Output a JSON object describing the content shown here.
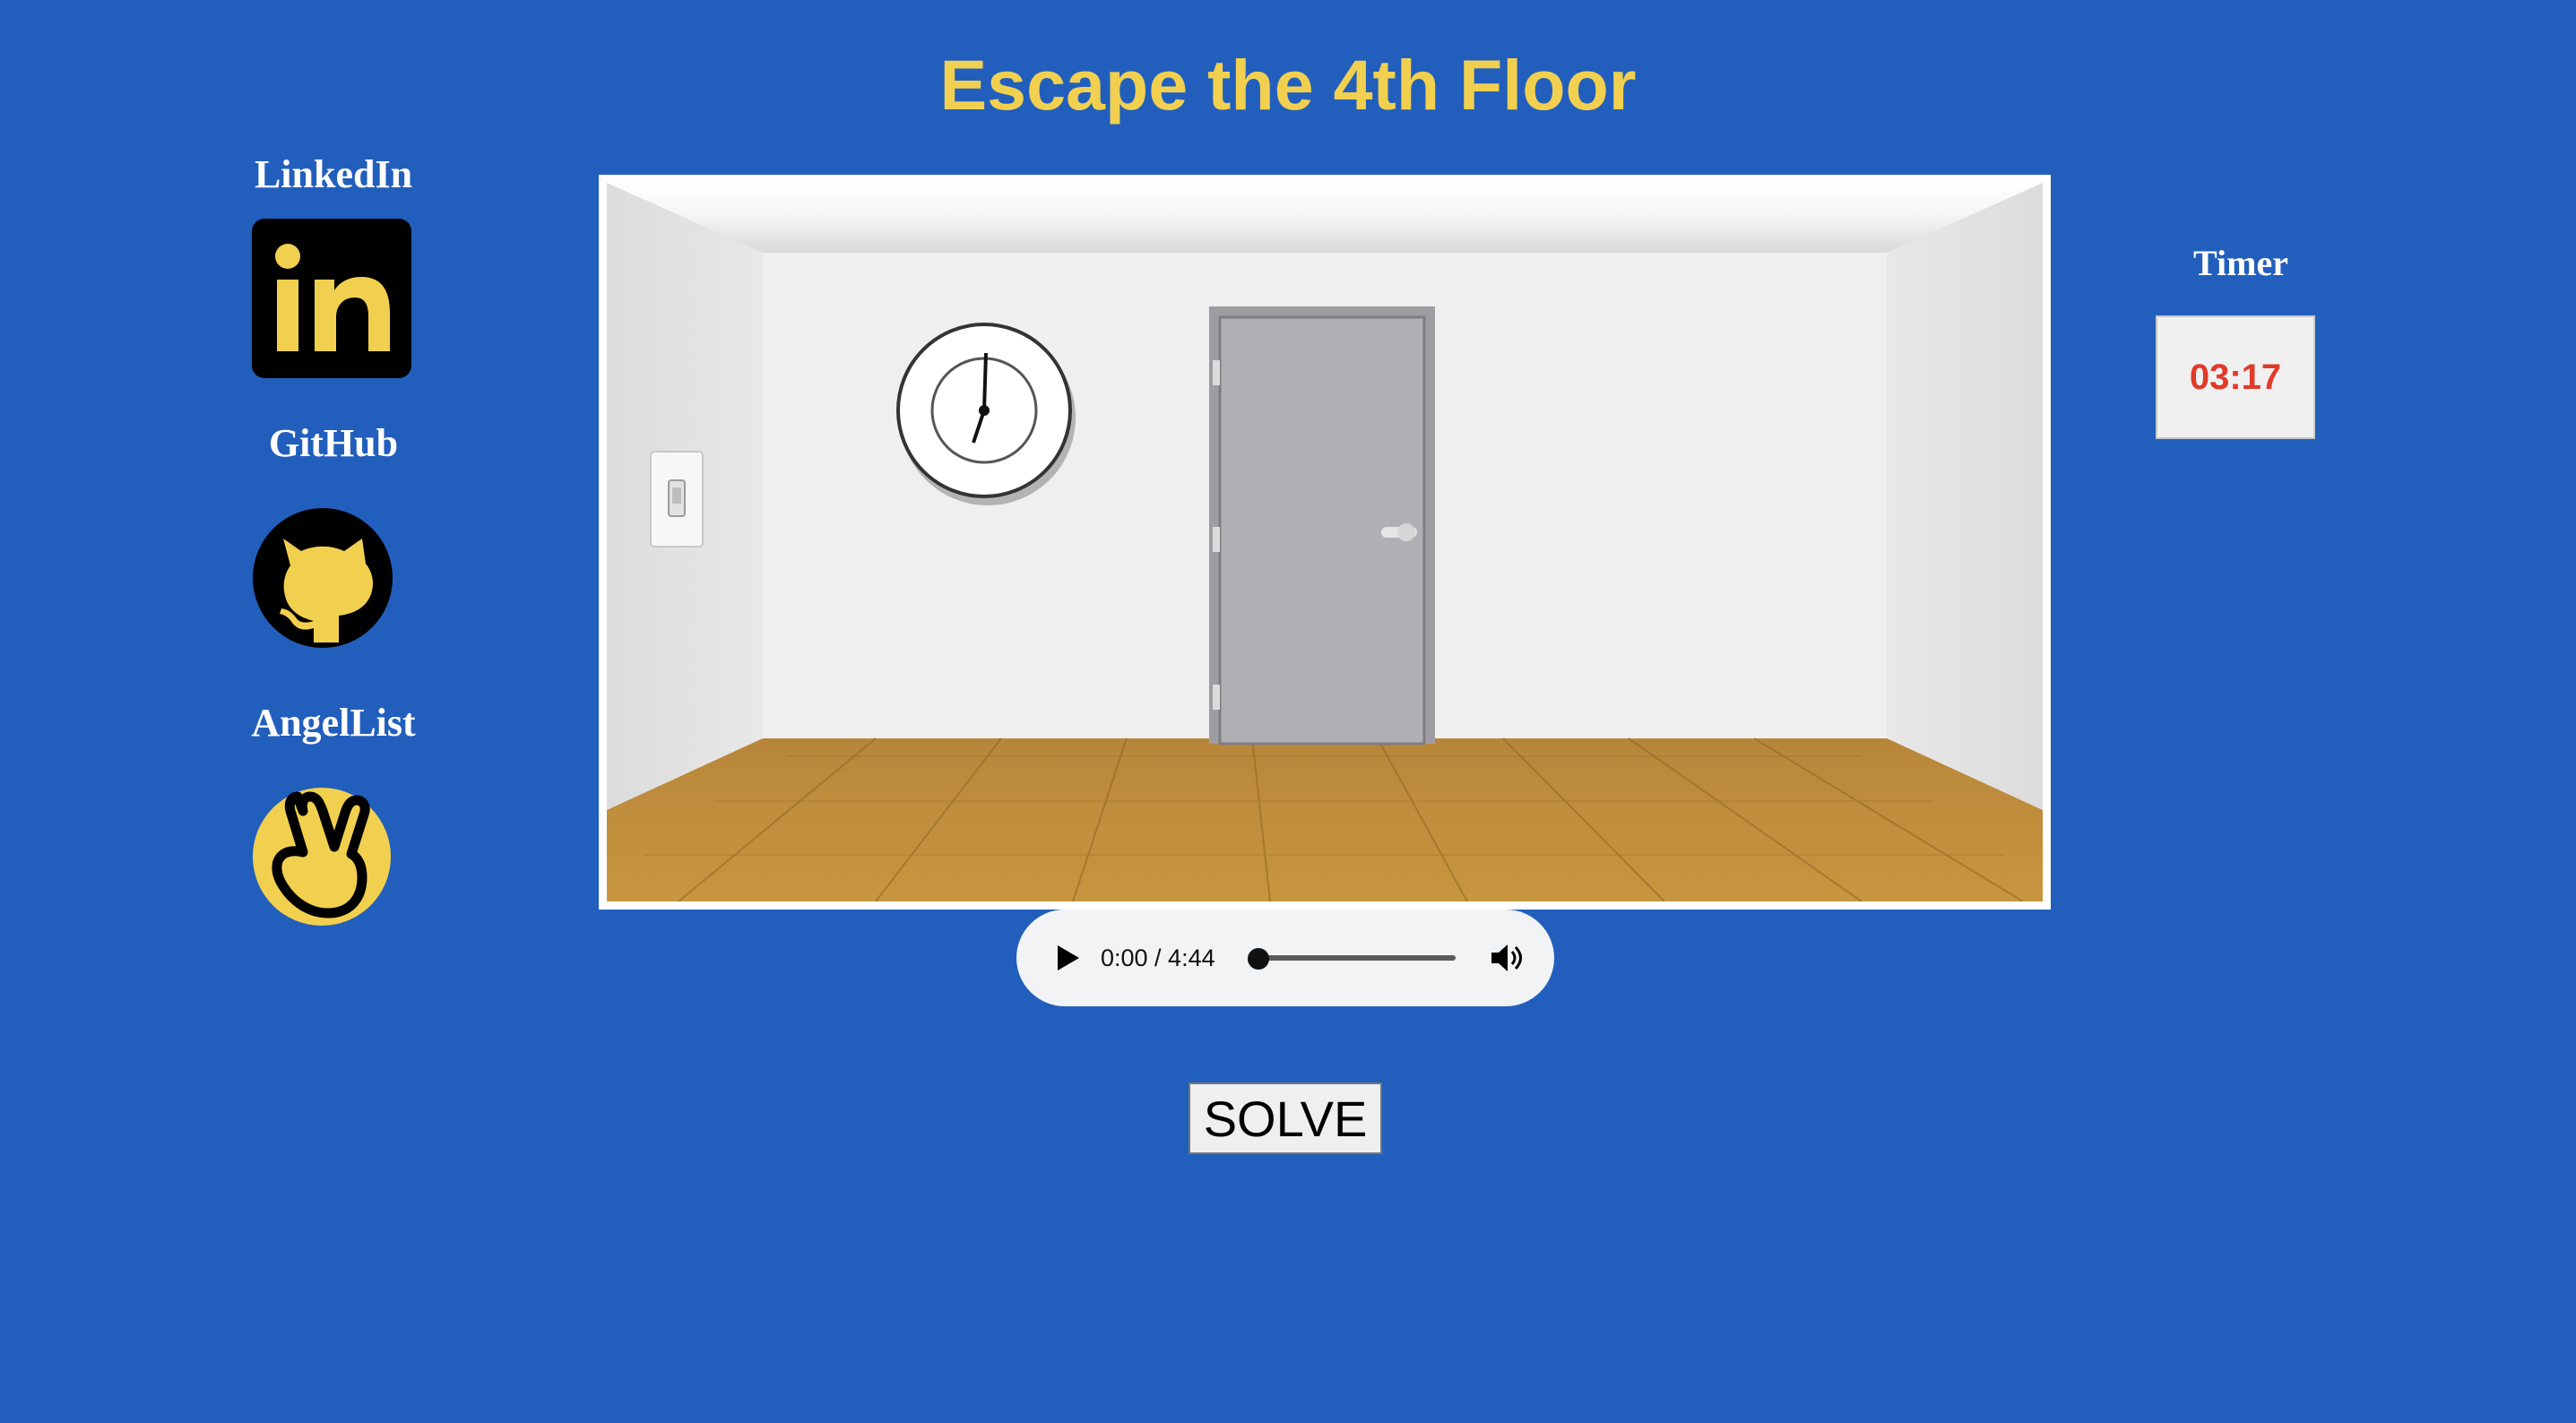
{
  "page": {
    "title": "Escape the 4th Floor"
  },
  "social": {
    "linkedin": {
      "label": "LinkedIn",
      "icon": "linkedin-icon"
    },
    "github": {
      "label": "GitHub",
      "icon": "github-icon"
    },
    "angellist": {
      "label": "AngelList",
      "icon": "angellist-icon"
    }
  },
  "timer": {
    "label": "Timer",
    "value": "03:17"
  },
  "scene": {
    "objects": [
      "wall-clock",
      "light-switch",
      "door",
      "wooden-floor"
    ]
  },
  "audio": {
    "time": "0:00 / 4:44",
    "progress": 0,
    "icons": [
      "play-icon",
      "volume-icon"
    ]
  },
  "solve": {
    "label": "SOLVE"
  },
  "colors": {
    "background": "#225fbd",
    "accent": "#f2d04f",
    "timer_text": "#e03a2a"
  }
}
